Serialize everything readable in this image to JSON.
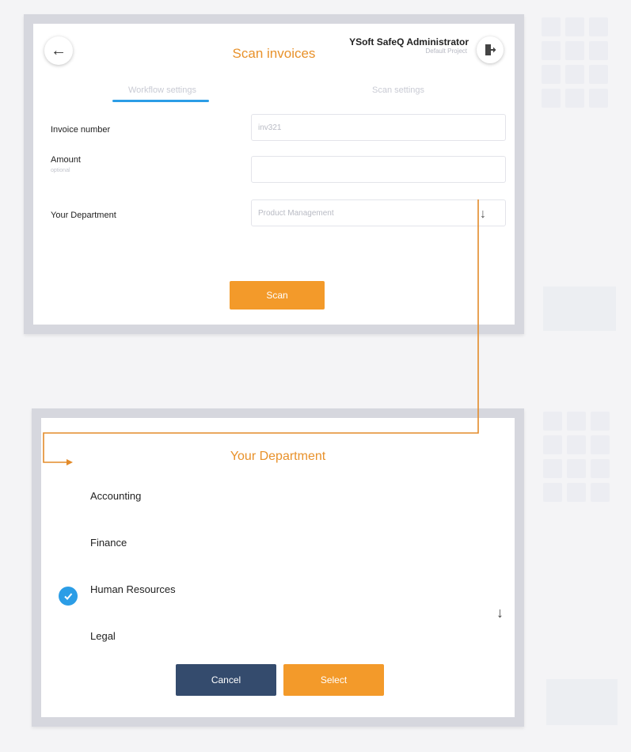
{
  "screen1": {
    "title": "Scan invoices",
    "user": {
      "name": "YSoft SafeQ Administrator",
      "profile": "Default Project"
    },
    "tabs": [
      {
        "label": "Workflow settings",
        "active": true
      },
      {
        "label": "Scan settings",
        "active": false
      }
    ],
    "fields": {
      "invoice": {
        "label": "Invoice number",
        "value": "inv321"
      },
      "amount": {
        "label": "Amount",
        "sublabel": "optional",
        "value": ""
      },
      "department": {
        "label": "Your Department",
        "value": "Product Management"
      }
    },
    "scan_label": "Scan"
  },
  "screen2": {
    "title": "Your Department",
    "options": [
      {
        "label": "Accounting",
        "selected": false
      },
      {
        "label": "Finance",
        "selected": false
      },
      {
        "label": "Human Resources",
        "selected": true
      },
      {
        "label": "Legal",
        "selected": false
      }
    ],
    "cancel_label": "Cancel",
    "select_label": "Select"
  },
  "colors": {
    "accent_orange": "#f39a2a",
    "title_orange": "#e8912a",
    "active_blue": "#2b9de6",
    "cancel_navy": "#344b6d",
    "frame_gray": "#d6d7de"
  },
  "icons": {
    "back": "arrow-left-icon",
    "logout": "logout-icon",
    "dropdown": "arrow-down-icon",
    "check": "check-icon",
    "scroll": "arrow-down-icon"
  }
}
